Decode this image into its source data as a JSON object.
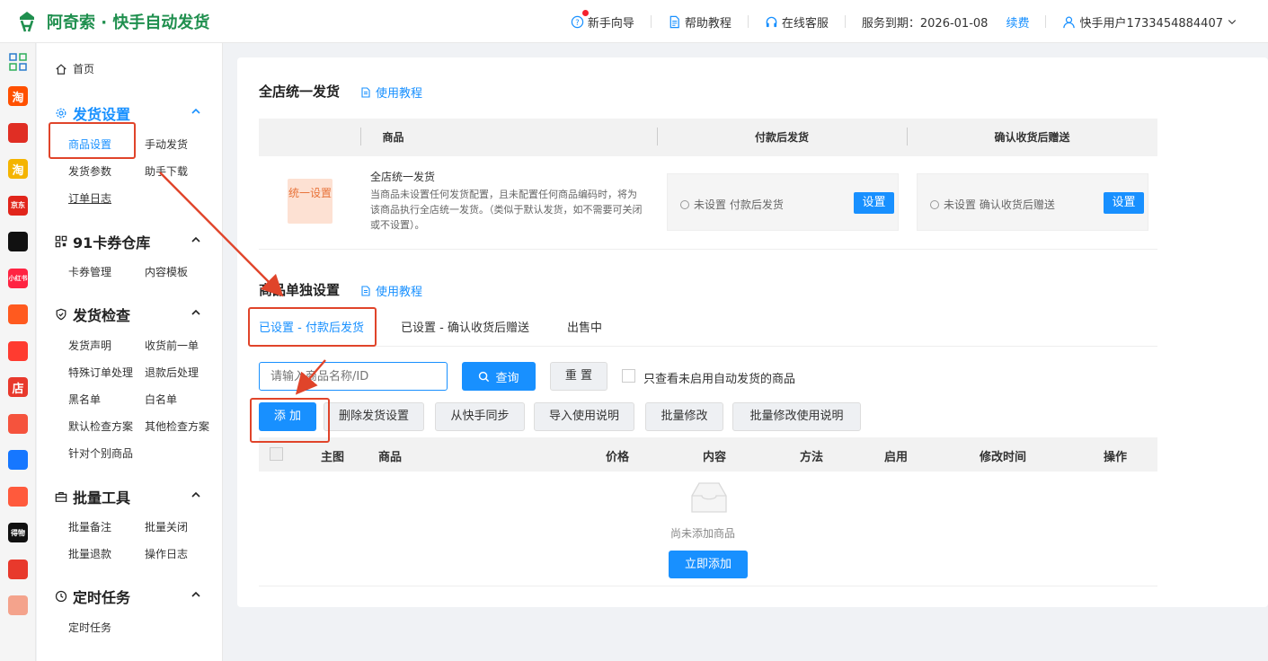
{
  "brand": {
    "name": "阿奇索 · 快手自动发货",
    "color": "#1f8f4e"
  },
  "topnav": {
    "guide": "新手向导",
    "help": "帮助教程",
    "service": "在线客服",
    "expire": "服务到期：2026-01-08",
    "renew": "续费",
    "user": "快手用户1733454884407"
  },
  "apps": [
    {
      "name": "taobao-app-icon",
      "text": "淘",
      "color": "#ff5000"
    },
    {
      "name": "pinduoduo-app-icon",
      "text": "",
      "color": "#e02e24"
    },
    {
      "name": "store-app-icon",
      "text": "淘",
      "color": "#f4b400"
    },
    {
      "name": "jd-app-icon",
      "text": "京东",
      "color": "#e1251b"
    },
    {
      "name": "douyin-app-icon",
      "text": "",
      "color": "#111111"
    },
    {
      "name": "xiaohongshu-app-icon",
      "text": "小红书",
      "color": "#ff2442"
    },
    {
      "name": "kuaishou-app-icon",
      "text": "",
      "color": "#ff5a1f"
    },
    {
      "name": "thumb-app-icon",
      "text": "",
      "color": "#ff3b30"
    },
    {
      "name": "dian-app-icon",
      "text": "店",
      "color": "#e8392c"
    },
    {
      "name": "bag-app-icon",
      "text": "",
      "color": "#f5533d"
    },
    {
      "name": "link-app-icon",
      "text": "",
      "color": "#1677ff"
    },
    {
      "name": "smile-app-icon",
      "text": "",
      "color": "#ff5a3c"
    },
    {
      "name": "dewu-app-icon",
      "text": "得物",
      "color": "#111111"
    },
    {
      "name": "bolt-app-icon",
      "text": "",
      "color": "#e8392c"
    },
    {
      "name": "shopee-app-icon",
      "text": "",
      "color": "#f4a38c"
    }
  ],
  "sidebar": {
    "home": "首页",
    "groups": [
      {
        "title": "发货设置",
        "items": [
          "商品设置",
          "手动发货",
          "发货参数",
          "助手下载",
          "订单日志"
        ]
      },
      {
        "title": "91卡券仓库",
        "items": [
          "卡券管理",
          "内容模板"
        ]
      },
      {
        "title": "发货检查",
        "items": [
          "发货声明",
          "收货前一单",
          "特殊订单处理",
          "退款后处理",
          "黑名单",
          "白名单",
          "默认检查方案",
          "其他检查方案",
          "针对个别商品"
        ]
      },
      {
        "title": "批量工具",
        "items": [
          "批量备注",
          "批量关闭",
          "批量退款",
          "操作日志"
        ]
      },
      {
        "title": "定时任务",
        "items": [
          "定时任务"
        ]
      }
    ]
  },
  "main": {
    "store_section": {
      "title": "全店统一发货",
      "tutorial": "使用教程",
      "headers": [
        "商品",
        "付款后发货",
        "确认收货后赠送"
      ],
      "badge": "统一设置",
      "row_title": "全店统一发货",
      "row_desc": "当商品未设置任何发货配置，且未配置任何商品编码时，将为该商品执行全店统一发货。（类似于默认发货，如不需要可关闭或不设置）。",
      "pay_status": "未设置 付款后发货",
      "confirm_status": "未设置 确认收货后赠送",
      "set_label": "设置"
    },
    "item_section": {
      "title": "商品单独设置",
      "tutorial": "使用教程",
      "tabs": [
        "已设置 - 付款后发货",
        "已设置 - 确认收货后赠送",
        "出售中"
      ],
      "search_placeholder": "请输入商品名称/ID",
      "query": "查询",
      "reset": "重 置",
      "only_unenabled": "只查看未启用自动发货的商品",
      "add": "添 加",
      "actions": [
        "删除发货设置",
        "从快手同步",
        "导入使用说明",
        "批量修改",
        "批量修改使用说明"
      ],
      "columns": [
        "主图",
        "商品",
        "价格",
        "内容",
        "方法",
        "启用",
        "修改时间",
        "操作"
      ],
      "empty_text": "尚未添加商品",
      "add_now": "立即添加"
    }
  },
  "colors": {
    "accent": "#1890ff",
    "annotation": "#e0442a"
  }
}
